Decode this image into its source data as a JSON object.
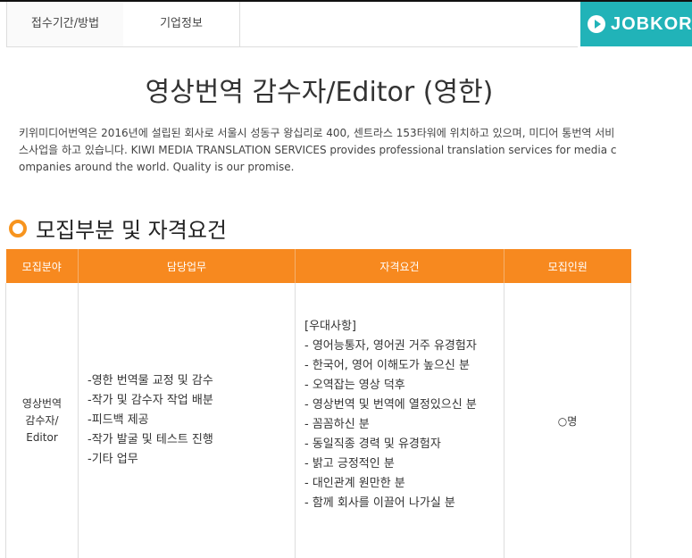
{
  "tabs": [
    "접수기간/방법",
    "기업정보"
  ],
  "banner": {
    "text": "JOBKORE"
  },
  "title": "영상번역 감수자/Editor (영한)",
  "intro": "키위미디어번역은 2016년에 설립된 회사로 서울시 성동구 왕십리로 400, 센트라스 153타워에 위치하고 있으며, 미디어 통번역 서비스사업을 하고 있습니다. KIWI MEDIA TRANSLATION SERVICES provides professional translation services for media companies around the world. Quality is our promise.",
  "section_title": "모집부분 및 자격요건",
  "table": {
    "headers": [
      "모집분야",
      "담당업무",
      "자격요건",
      "모집인원"
    ],
    "field_lines": [
      "영상번역",
      "감수자/",
      "Editor"
    ],
    "duties": [
      "-영한 번역물 교정 및 감수",
      "-작가 및 감수자 작업 배분",
      "-피드백 제공",
      "-작가 발굴 및 테스트 진행",
      "-기타 업무"
    ],
    "requirements": [
      "[우대사항]",
      "- 영어능통자, 영어권 거주 유경험자",
      "- 한국어, 영어 이해도가 높으신 분",
      "- 오역잡는 영상 덕후",
      "- 영상번역 및 번역에 열정있으신 분",
      "- 꼼꼼하신 분",
      "- 동일직종 경력 및 유경험자",
      "- 밝고 긍정적인 분",
      "- 대인관계 원만한 분",
      "- 함께 회사를 이끌어 나가실 분"
    ],
    "count": "○명"
  },
  "colors": {
    "accent": "#f7891f",
    "banner": "#21b3b8"
  }
}
